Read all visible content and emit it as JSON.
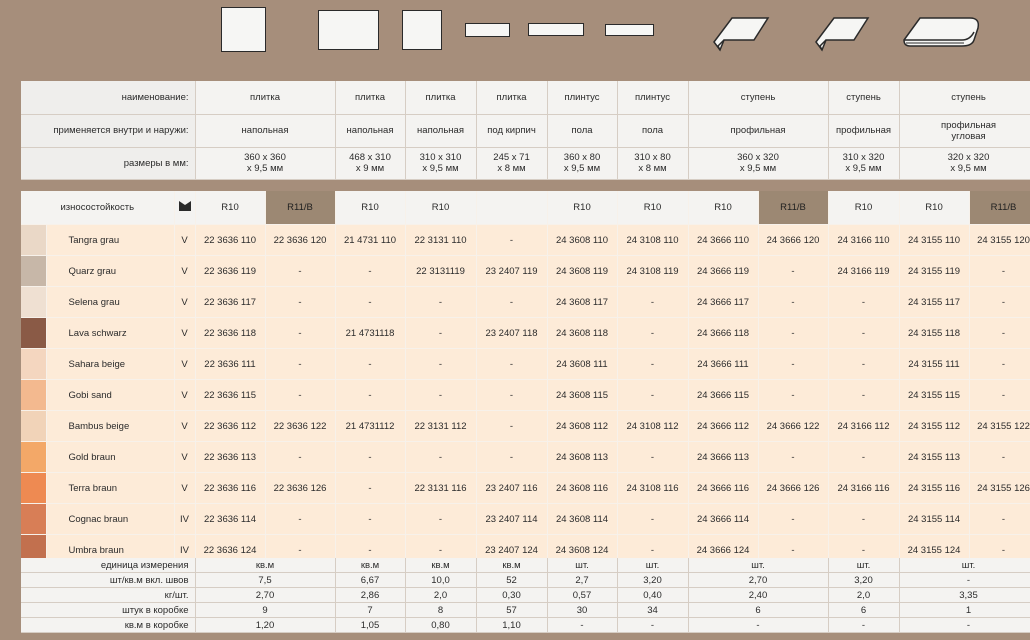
{
  "header": {
    "label_name": "наименование:",
    "label_use": "применяется внутри и наружи:",
    "label_size": "размеры в мм:",
    "columns": [
      {
        "name": "плитка",
        "use": "напольная",
        "size1": "360 х 360",
        "size2": "х 9,5 мм"
      },
      {
        "name": "плитка",
        "use": "напольная",
        "size1": "468 х 310",
        "size2": "х 9 мм"
      },
      {
        "name": "плитка",
        "use": "напольная",
        "size1": "310 х 310",
        "size2": "х 9,5 мм"
      },
      {
        "name": "плитка",
        "use": "под кирпич",
        "size1": "245 х 71",
        "size2": "х 8 мм"
      },
      {
        "name": "плинтус",
        "use": "пола",
        "size1": "360 х 80",
        "size2": "х 9,5 мм"
      },
      {
        "name": "плинтус",
        "use": "пола",
        "size1": "310 х 80",
        "size2": "х 8 мм"
      },
      {
        "name": "ступень",
        "use": "профильная",
        "use2": "",
        "size1": "360 х 320",
        "size2": "х 9,5 мм"
      },
      {
        "name": "ступень",
        "use": "профильная",
        "use2": "",
        "size1": "310 х 320",
        "size2": "х 9,5 мм"
      },
      {
        "name": "ступень",
        "use": "профильная",
        "use2": "угловая",
        "size1": "320 х 320",
        "size2": "х 9,5 мм"
      }
    ]
  },
  "main": {
    "wear_label": "износостойкость",
    "wear_icon": "abrasion-icon",
    "ratings": [
      "R10",
      "R11/B",
      "R10",
      "R10",
      "",
      "R10",
      "R10",
      "R10",
      "R11/B",
      "R10",
      "R10",
      "R11/B"
    ],
    "rows": [
      {
        "name": "Tangra grau",
        "cls": "V",
        "color": "#ead8c7",
        "codes": [
          "22 3636 110",
          "22 3636 120",
          "21 4731 110",
          "22 3131 110",
          "-",
          "24 3608 110",
          "24 3108 110",
          "24 3666 110",
          "24 3666 120",
          "24 3166 110",
          "24 3155 110",
          "24 3155 120"
        ]
      },
      {
        "name": "Quarz grau",
        "cls": "V",
        "color": "#c7b7a8",
        "codes": [
          "22 3636 119",
          "-",
          "-",
          "22 3131119",
          "23 2407 119",
          "24 3608 119",
          "24 3108 119",
          "24 3666 119",
          "-",
          "24 3166 119",
          "24 3155 119",
          "-"
        ]
      },
      {
        "name": "Selena grau",
        "cls": "V",
        "color": "#efe0d2",
        "codes": [
          "22 3636 117",
          "-",
          "-",
          "-",
          "-",
          "24 3608 117",
          "-",
          "24 3666 117",
          "-",
          "-",
          "24 3155 117",
          "-"
        ]
      },
      {
        "name": "Lava schwarz",
        "cls": "V",
        "color": "#8a5a46",
        "codes": [
          "22 3636 118",
          "-",
          "21 4731118",
          "-",
          "23 2407 118",
          "24 3608 118",
          "-",
          "24 3666 118",
          "-",
          "-",
          "24 3155 118",
          "-"
        ]
      },
      {
        "name": "Sahara beige",
        "cls": "V",
        "color": "#f4d6bf",
        "codes": [
          "22 3636 111",
          "-",
          "-",
          "-",
          "-",
          "24 3608 111",
          "-",
          "24 3666 111",
          "-",
          "-",
          "24 3155 111",
          "-"
        ]
      },
      {
        "name": "Gobi sand",
        "cls": "V",
        "color": "#f3b98f",
        "codes": [
          "22 3636 115",
          "-",
          "-",
          "-",
          "-",
          "24 3608 115",
          "-",
          "24 3666 115",
          "-",
          "-",
          "24 3155 115",
          "-"
        ]
      },
      {
        "name": "Bambus beige",
        "cls": "V",
        "color": "#f1d3b8",
        "codes": [
          "22 3636 112",
          "22 3636 122",
          "21 4731112",
          "22 3131 112",
          "-",
          "24 3608 112",
          "24 3108 112",
          "24 3666 112",
          "24 3666 122",
          "24 3166 112",
          "24 3155 112",
          "24 3155 122"
        ]
      },
      {
        "name": "Gold braun",
        "cls": "V",
        "color": "#f3a868",
        "codes": [
          "22 3636 113",
          "-",
          "-",
          "-",
          "-",
          "24 3608 113",
          "-",
          "24 3666 113",
          "-",
          "-",
          "24 3155 113",
          "-"
        ]
      },
      {
        "name": "Terra braun",
        "cls": "V",
        "color": "#ee8a52",
        "codes": [
          "22 3636 116",
          "22 3636 126",
          "-",
          "22 3131 116",
          "23 2407 116",
          "24 3608 116",
          "24 3108 116",
          "24 3666 116",
          "24 3666 126",
          "24 3166 116",
          "24 3155 116",
          "24 3155 126"
        ]
      },
      {
        "name": "Cognac braun",
        "cls": "IV",
        "color": "#d87e56",
        "codes": [
          "22 3636 114",
          "-",
          "-",
          "-",
          "23 2407 114",
          "24 3608 114",
          "-",
          "24 3666 114",
          "-",
          "-",
          "24 3155 114",
          "-"
        ]
      },
      {
        "name": "Umbra braun",
        "cls": "IV",
        "color": "#c2704e",
        "codes": [
          "22 3636 124",
          "-",
          "-",
          "-",
          "23 2407 124",
          "24 3608 124",
          "-",
          "24 3666 124",
          "-",
          "-",
          "24 3155 124",
          "-"
        ]
      }
    ]
  },
  "footer": {
    "rows": [
      {
        "label": "единица измерения",
        "values": [
          "кв.м",
          "кв.м",
          "кв.м",
          "кв.м",
          "шт.",
          "шт.",
          "шт.",
          "шт.",
          "шт."
        ]
      },
      {
        "label": "шт/кв.м вкл. швов",
        "values": [
          "7,5",
          "6,67",
          "10,0",
          "52",
          "2,7",
          "3,20",
          "2,70",
          "3,20",
          "-"
        ]
      },
      {
        "label": "кг/шт.",
        "values": [
          "2,70",
          "2,86",
          "2,0",
          "0,30",
          "0,57",
          "0,40",
          "2,40",
          "2,0",
          "3,35"
        ]
      },
      {
        "label": "штук в коробке",
        "values": [
          "9",
          "7",
          "8",
          "57",
          "30",
          "34",
          "6",
          "6",
          "1"
        ]
      },
      {
        "label": "кв.м в коробке",
        "values": [
          "1,20",
          "1,05",
          "0,80",
          "1,10",
          "-",
          "-",
          "-",
          "-",
          "-"
        ]
      }
    ]
  }
}
